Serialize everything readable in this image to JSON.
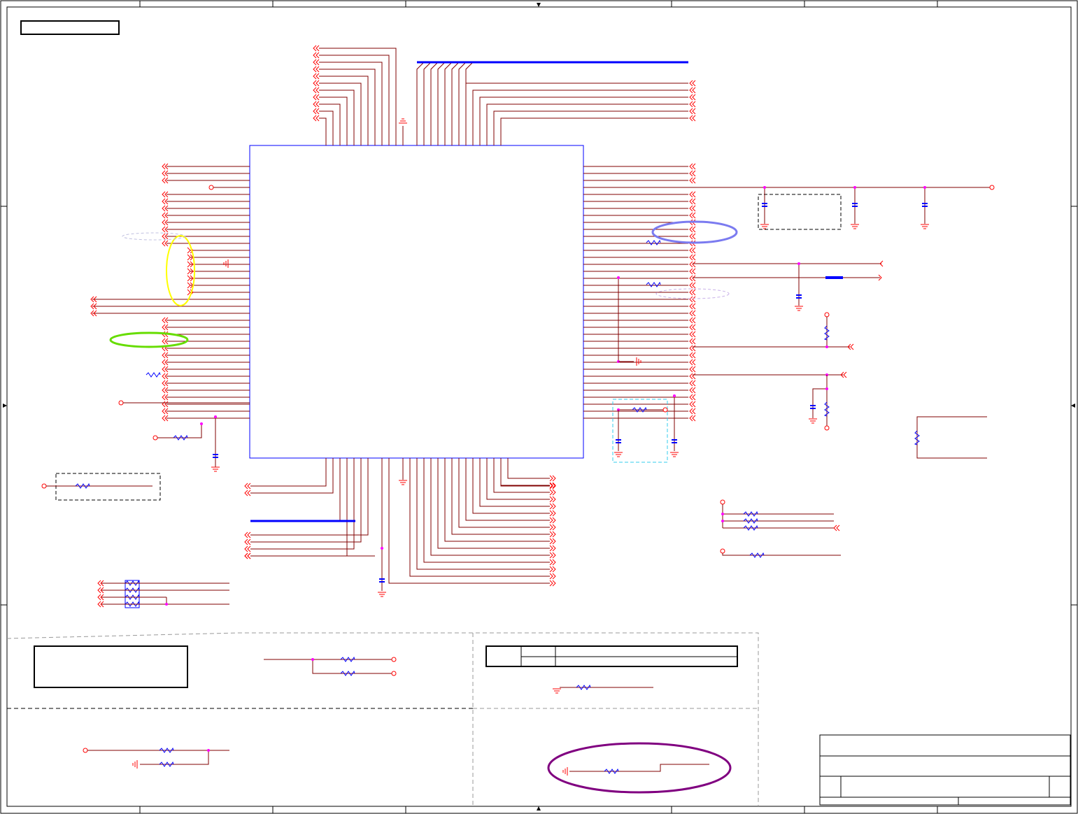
{
  "sheet": {
    "title_block_text": "",
    "note_box_text": "",
    "revision_box_text": ""
  },
  "colors": {
    "frame": "#000000",
    "wire": "#800000",
    "port": "#ff0000",
    "component": "#0000ff",
    "bus": "#0000ff",
    "junction": "#ff00ff",
    "highlight_yellow": "#ffff00",
    "highlight_green": "#66dd00",
    "highlight_blue": "#7b7bf0",
    "highlight_purple": "#800080",
    "highlight_cyan": "#33ccee"
  },
  "components": [
    "main-ic",
    "resistor",
    "capacitor",
    "resistor-array",
    "ground-symbol",
    "power-port"
  ]
}
